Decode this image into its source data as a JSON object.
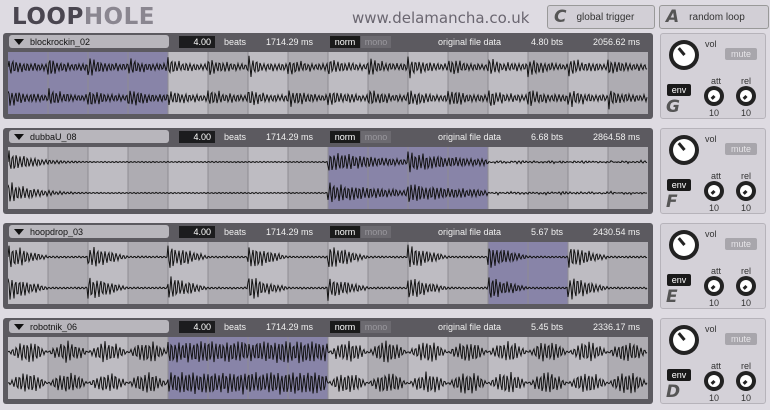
{
  "header": {
    "logo_prefix": "LOOP",
    "logo_suffix": "HOLE",
    "url": "www.delamancha.co.uk",
    "buttons": [
      {
        "letter": "C",
        "label": "global trigger"
      },
      {
        "letter": "A",
        "label": "random loop"
      }
    ]
  },
  "labels": {
    "beats": "beats",
    "original": "original file data",
    "norm": "norm",
    "mono": "mono",
    "vol": "vol",
    "mute": "mute",
    "env": "env",
    "att": "att",
    "rel": "rel"
  },
  "tracks": [
    {
      "file": "blockrockin_02",
      "beats": "4.00",
      "loop_ms": "1714.29 ms",
      "bts": "4.80  bts",
      "file_ms": "2056.62 ms",
      "letter": "G",
      "att": "10",
      "rel": "10",
      "selection_cells": [
        0,
        1,
        2,
        3
      ],
      "style": "dense_decay"
    },
    {
      "file": "dubbaU_08",
      "beats": "4.00",
      "loop_ms": "1714.29 ms",
      "bts": "6.68  bts",
      "file_ms": "2864.58 ms",
      "letter": "F",
      "att": "10",
      "rel": "10",
      "selection_cells": [
        8,
        9,
        10,
        11
      ],
      "style": "sparse_blocks"
    },
    {
      "file": "hoopdrop_03",
      "beats": "4.00",
      "loop_ms": "1714.29 ms",
      "bts": "5.67  bts",
      "file_ms": "2430.54 ms",
      "letter": "E",
      "att": "10",
      "rel": "10",
      "selection_cells": [
        12,
        13
      ],
      "style": "regular_bursts"
    },
    {
      "file": "robotnik_06",
      "beats": "4.00",
      "loop_ms": "1714.29 ms",
      "bts": "5.45  bts",
      "file_ms": "2336.17 ms",
      "letter": "D",
      "att": "10",
      "rel": "10",
      "selection_cells": [
        4,
        5,
        6,
        7
      ],
      "style": "bumps"
    }
  ]
}
